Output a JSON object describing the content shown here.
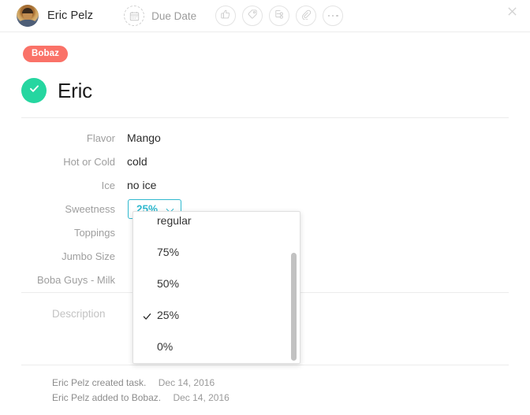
{
  "header": {
    "user_name": "Eric Pelz",
    "avatar_icon": "avatar",
    "due_date_label": "Due Date",
    "calendar_icon": "calendar-icon",
    "close_icon": "close-icon",
    "icon_buttons": [
      {
        "name": "like-icon",
        "label": "Like"
      },
      {
        "name": "tag-icon",
        "label": "Tag"
      },
      {
        "name": "subtask-icon",
        "label": "Subtask"
      },
      {
        "name": "attachment-icon",
        "label": "Attach"
      },
      {
        "name": "more-icon",
        "label": "More"
      }
    ]
  },
  "task": {
    "project_tag": "Bobaz",
    "tag_color": "#fa7268",
    "title": "Eric",
    "complete_color": "#25d6a0",
    "check_icon": "check-icon"
  },
  "fields": [
    {
      "label": "Flavor",
      "value": "Mango"
    },
    {
      "label": "Hot or Cold",
      "value": "cold"
    },
    {
      "label": "Ice",
      "value": "no ice"
    },
    {
      "label": "Sweetness",
      "value": "25%",
      "type": "select"
    },
    {
      "label": "Toppings",
      "value": ""
    },
    {
      "label": "Jumbo Size",
      "value": ""
    },
    {
      "label": "Boba Guys - Milk",
      "value": ""
    }
  ],
  "sweetness_select": {
    "selected": "25%",
    "accent_color": "#2fb9cf",
    "chevron_icon": "chevron-down-icon",
    "options": [
      {
        "label": "regular",
        "checked": false
      },
      {
        "label": "75%",
        "checked": false
      },
      {
        "label": "50%",
        "checked": false
      },
      {
        "label": "25%",
        "checked": true
      },
      {
        "label": "0%",
        "checked": false
      }
    ]
  },
  "description": {
    "placeholder": "Description"
  },
  "activity": [
    {
      "text": "Eric Pelz created task.",
      "date": "Dec 14, 2016"
    },
    {
      "text": "Eric Pelz added to Bobaz.",
      "date": "Dec 14, 2016"
    }
  ]
}
